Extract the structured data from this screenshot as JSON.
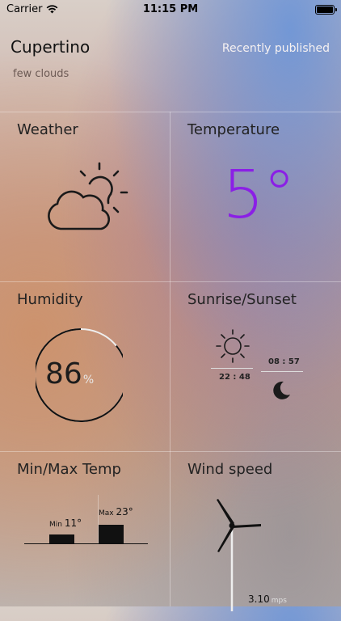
{
  "status_bar": {
    "carrier": "Carrier",
    "time": "11:15 PM"
  },
  "location": {
    "city": "Cupertino",
    "description": "few clouds",
    "published": "Recently published"
  },
  "cells": {
    "weather": {
      "title": "Weather",
      "icon": "cloud-sun-icon"
    },
    "temperature": {
      "title": "Temperature",
      "value": "5°",
      "color": "#8b1fe6"
    },
    "humidity": {
      "title": "Humidity",
      "value": "86",
      "unit": "%",
      "level_percent": 86
    },
    "sunrise_sunset": {
      "title": "Sunrise/Sunset",
      "sunrise": "22 : 48",
      "sunset": "08 : 57"
    },
    "min_max": {
      "title": "Min/Max Temp",
      "min_label": "Min",
      "min_value": "11°",
      "max_label": "Max",
      "max_value": "23°",
      "min": 11,
      "max": 23
    },
    "wind": {
      "title": "Wind speed",
      "value": "3.10",
      "unit": "mps"
    }
  }
}
